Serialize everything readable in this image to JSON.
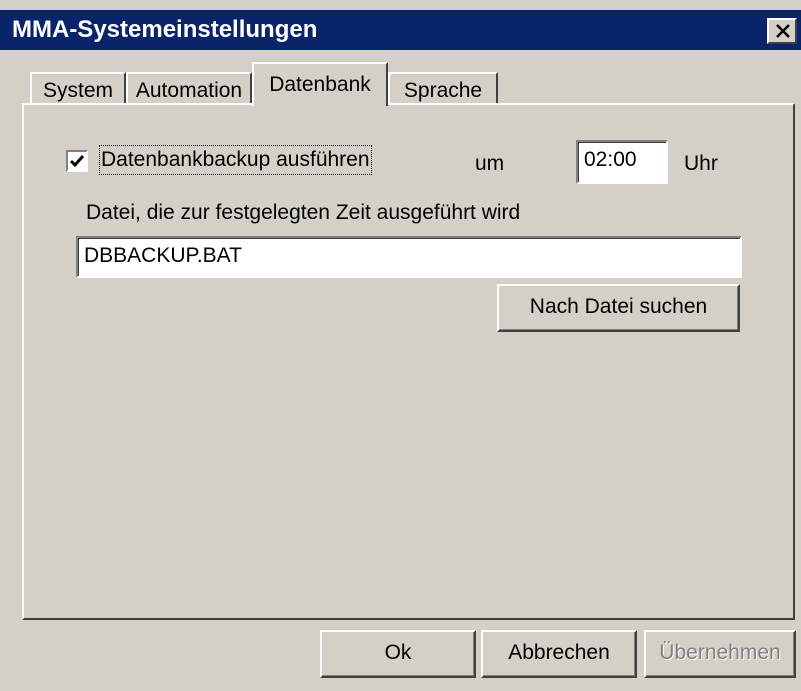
{
  "window": {
    "title": "MMA-Systemeinstellungen"
  },
  "tabs": [
    {
      "label": "System",
      "active": false
    },
    {
      "label": "Automation",
      "active": false
    },
    {
      "label": "Datenbank",
      "active": true
    },
    {
      "label": "Sprache",
      "active": false
    }
  ],
  "database": {
    "backup_checkbox_label": "Datenbankbackup ausführen",
    "backup_enabled": true,
    "at_label": "um",
    "time_value": "02:00",
    "time_unit": "Uhr",
    "file_label": "Datei, die zur festgelegten Zeit ausgeführt wird",
    "file_value": "DBBACKUP.BAT",
    "browse_label": "Nach Datei suchen"
  },
  "footer": {
    "ok_label": "Ok",
    "cancel_label": "Abbrechen",
    "apply_label": "Übernehmen"
  },
  "colors": {
    "titlebar": "#0a246a",
    "face": "#d4d0c8"
  }
}
